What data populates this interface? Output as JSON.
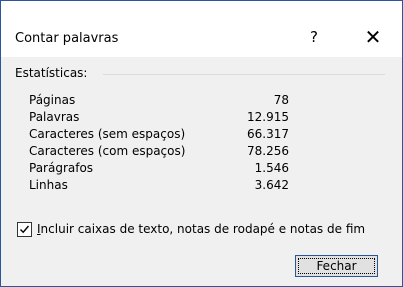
{
  "dialog": {
    "title": "Contar palavras",
    "help_label": "?",
    "close_glyph": "✕"
  },
  "statistics": {
    "heading": "Estatísticas:",
    "rows": [
      {
        "label": "Páginas",
        "value": "78"
      },
      {
        "label": "Palavras",
        "value": "12.915"
      },
      {
        "label": "Caracteres (sem espaços)",
        "value": "66.317"
      },
      {
        "label": "Caracteres (com espaços)",
        "value": "78.256"
      },
      {
        "label": "Parágrafos",
        "value": "1.546"
      },
      {
        "label": "Linhas",
        "value": "3.642"
      }
    ]
  },
  "option": {
    "checked": true,
    "label_first_letter": "I",
    "label_rest": "ncluir caixas de texto, notas de rodapé e notas de fim"
  },
  "buttons": {
    "close_label": "Fechar"
  },
  "colors": {
    "accent": "#2b579a",
    "background": "#f0f0f0"
  }
}
